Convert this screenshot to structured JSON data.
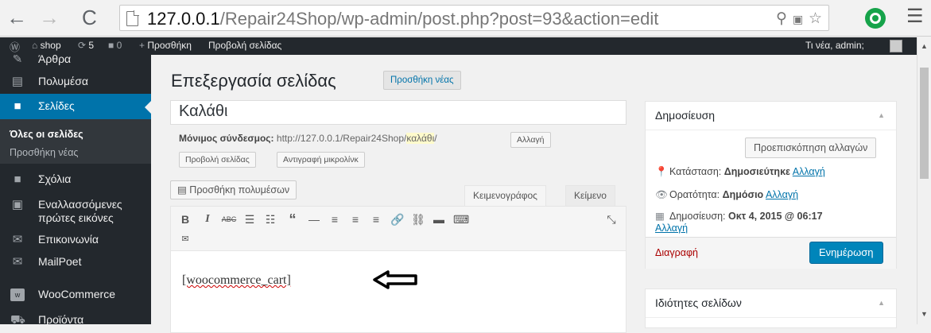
{
  "browser": {
    "url_host": "127.0.0.1",
    "url_path": "/Repair24Shop/wp-admin/post.php?post=93&action=edit"
  },
  "adminbar": {
    "site_name": "shop",
    "updates_count": "5",
    "comments_count": "0",
    "new_label": "Προσθήκη",
    "view_page_label": "Προβολή σελίδας",
    "greeting": "Τι νέα, admin;"
  },
  "sidebar": {
    "items": [
      {
        "label": "Άρθρα"
      },
      {
        "label": "Πολυμέσα"
      },
      {
        "label": "Σελίδες"
      },
      {
        "label": "Σχόλια"
      },
      {
        "label": "Εναλλασσόμενες"
      },
      {
        "label": "πρώτες εικόνες"
      },
      {
        "label": "Επικοινωνία"
      },
      {
        "label": "MailPoet"
      },
      {
        "label": "WooCommerce"
      },
      {
        "label": "Προϊόντα"
      }
    ],
    "submenu": {
      "all_pages": "Όλες οι σελίδες",
      "add_new": "Προσθήκη νέας"
    }
  },
  "main": {
    "page_title": "Επεξεργασία σελίδας",
    "add_new_button": "Προσθήκη νέας",
    "post_title": "Καλάθι",
    "permalink": {
      "label": "Μόνιμος σύνδεσμος:",
      "base": "http://127.0.0.1/Repair24Shop/",
      "slug": "καλάθι",
      "trail": "/",
      "change_button": "Αλλαγή",
      "view_page_button": "Προβολή σελίδας",
      "shortlink_button": "Αντιγραφή μικρολίνκ"
    },
    "add_media_button": "Προσθήκη πολυμέσων",
    "tab_visual": "Κειμενογράφος",
    "tab_text": "Κείμενο",
    "toolbar": {
      "bold": "B",
      "italic": "I"
    },
    "editor_content": "[woocommerce_cart]"
  },
  "publish_box": {
    "title": "Δημοσίευση",
    "preview_button": "Προεπισκόπηση αλλαγών",
    "status_text": "Κατάσταση: ",
    "status_value": "Δημοσιεύτηκε",
    "visibility_text": "Ορατότητα: ",
    "visibility_value": "Δημόσιο",
    "published_text": "Δημοσίευση: ",
    "published_date": "Οκτ 4, 2015 @ 06:17",
    "change_link": "Αλλαγή",
    "trash_link": "Διαγραφή",
    "update_button": "Ενημέρωση"
  },
  "attributes_box": {
    "title": "Ιδιότητες σελίδων"
  },
  "colors": {
    "admin_dark": "#23282d",
    "accent_blue": "#0073aa",
    "primary_button": "#0085ba"
  }
}
